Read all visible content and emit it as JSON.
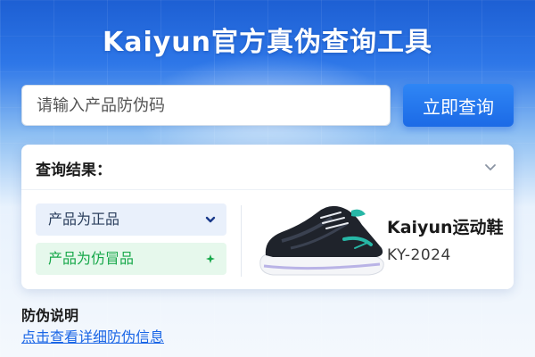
{
  "header": {
    "title": "Kaiyun官方真伪查询工具"
  },
  "search": {
    "placeholder": "请输入产品防伪码",
    "value": "",
    "button_label": "立即查询"
  },
  "result": {
    "title": "查询结果：",
    "collapse_icon": "chevron-down-icon",
    "statuses": [
      {
        "label": "产品为正品",
        "icon": "chevron-down-icon",
        "color": "#1a3a8a",
        "background": "#e9f0fb"
      },
      {
        "label": "产品为仿冒品",
        "icon": "sparkle-icon",
        "color": "#17a84a",
        "background": "#e6f8ec"
      }
    ],
    "product": {
      "name": "Kaiyun运动鞋",
      "code": "KY-2024",
      "image": "running-shoe-image"
    }
  },
  "note": {
    "title": "防伪说明",
    "link_label": "点击查看详细防伪信息"
  },
  "colors": {
    "brand": "#1c6ae6",
    "link": "#1a66e6",
    "fake": "#17a84a"
  }
}
